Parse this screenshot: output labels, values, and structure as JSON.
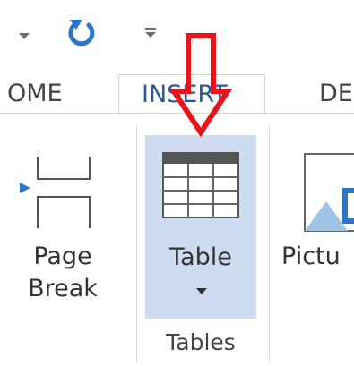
{
  "qat": {
    "customize_icon": "dropdown-arrow-icon",
    "redo_icon": "redo-icon",
    "more_icon": "customize-qat-icon"
  },
  "tabs": [
    {
      "label": "OME",
      "state": "partial"
    },
    {
      "label": "INSERT",
      "state": "active"
    },
    {
      "label": "DE",
      "state": "partial"
    }
  ],
  "buttons": {
    "page_break": {
      "line1": "Page",
      "line2": "Break",
      "icon": "page-break-icon"
    },
    "table": {
      "label": "Table",
      "icon": "table-grid-icon",
      "dropdown": "chevron-down-icon"
    },
    "pictures": {
      "label": "Pictu",
      "icon": "picture-icon"
    }
  },
  "groups": {
    "tables": "Tables"
  },
  "annotation": {
    "icon": "red-arrow-down-icon",
    "color": "#e8141c"
  },
  "colors": {
    "accent": "#2b579a",
    "hover": "#cddcf0",
    "annotation": "#e8141c"
  }
}
